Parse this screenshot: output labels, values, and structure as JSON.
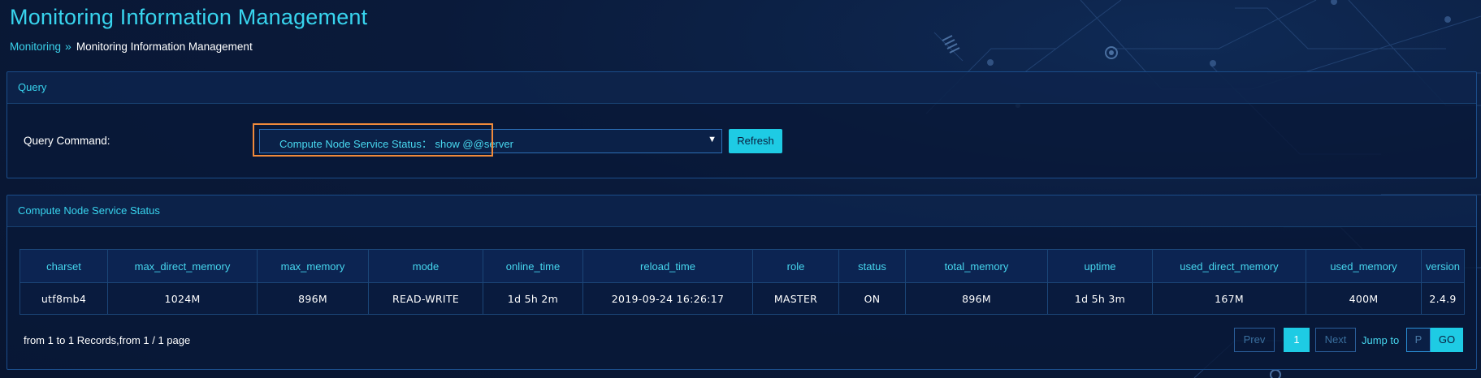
{
  "header": {
    "title": "Monitoring Information Management",
    "breadcrumb": {
      "root": "Monitoring",
      "separator": "»",
      "current": "Monitoring Information Management"
    }
  },
  "query": {
    "panel_title": "Query",
    "command_label": "Query Command:",
    "selected_command": "Compute Node Service Status： show @@server",
    "caret": "▼",
    "refresh_label": "Refresh"
  },
  "status": {
    "panel_title": "Compute Node Service Status",
    "columns": [
      "charset",
      "max_direct_memory",
      "max_memory",
      "mode",
      "online_time",
      "reload_time",
      "role",
      "status",
      "total_memory",
      "uptime",
      "used_direct_memory",
      "used_memory",
      "version"
    ],
    "rows": [
      [
        "utf8mb4",
        "1024M",
        "896M",
        "READ-WRITE",
        "1d 5h 2m",
        "2019-09-24 16:26:17",
        "MASTER",
        "ON",
        "896M",
        "1d 5h 3m",
        "167M",
        "400M",
        "2.4.9"
      ]
    ]
  },
  "pagination": {
    "records_info": "from 1 to 1 Records,from 1 / 1 page",
    "prev_label": "Prev",
    "current_page": "1",
    "next_label": "Next",
    "jump_label": "Jump to",
    "page_placeholder": "P",
    "go_label": "GO"
  },
  "colors": {
    "accent": "#1ecbe4",
    "title": "#38d4ee",
    "highlight": "#f08a3b",
    "background": "#0a1a3a"
  }
}
